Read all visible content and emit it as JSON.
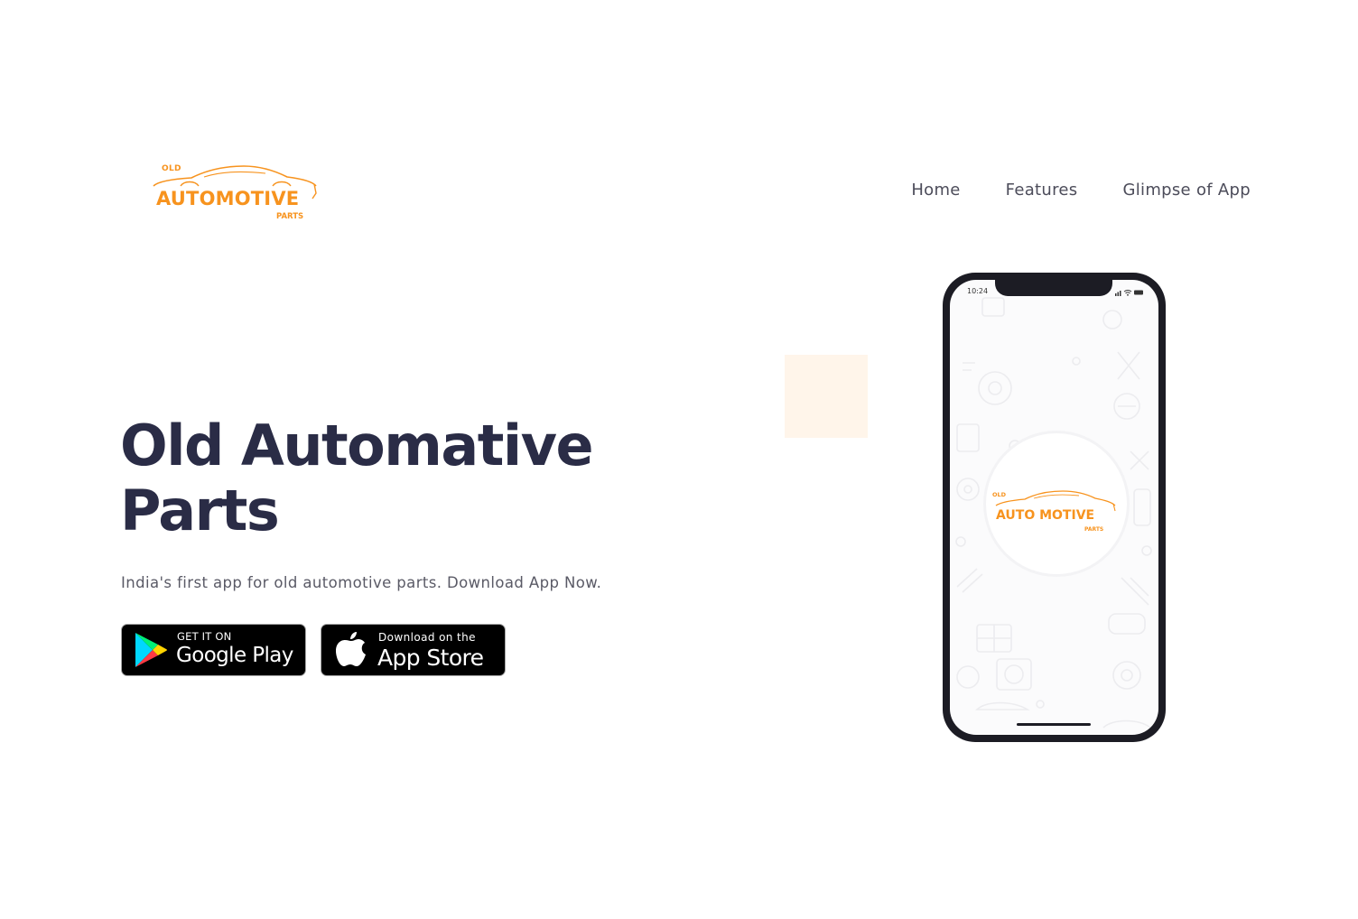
{
  "brand": {
    "logo_top": "OLD",
    "logo_main": "AUTOMOTIVE",
    "logo_bottom": "PARTS",
    "accent_color": "#f7931e"
  },
  "nav": {
    "items": [
      {
        "label": "Home"
      },
      {
        "label": "Features"
      },
      {
        "label": "Glimpse of App"
      }
    ]
  },
  "hero": {
    "title": "Old Automative Parts",
    "subtitle": "India's first app for old automotive parts. Download App Now.",
    "title_color": "#2a2c46"
  },
  "store_buttons": {
    "google_play": {
      "small": "GET IT ON",
      "big": "Google Play",
      "icon": "google-play-icon"
    },
    "app_store": {
      "small": "Download on the",
      "big": "App Store",
      "icon": "apple-icon"
    }
  },
  "phone": {
    "status_time": "10:24",
    "app_logo_top": "OLD",
    "app_logo_main": "AUTO MOTIVE",
    "app_logo_bottom": "PARTS"
  }
}
